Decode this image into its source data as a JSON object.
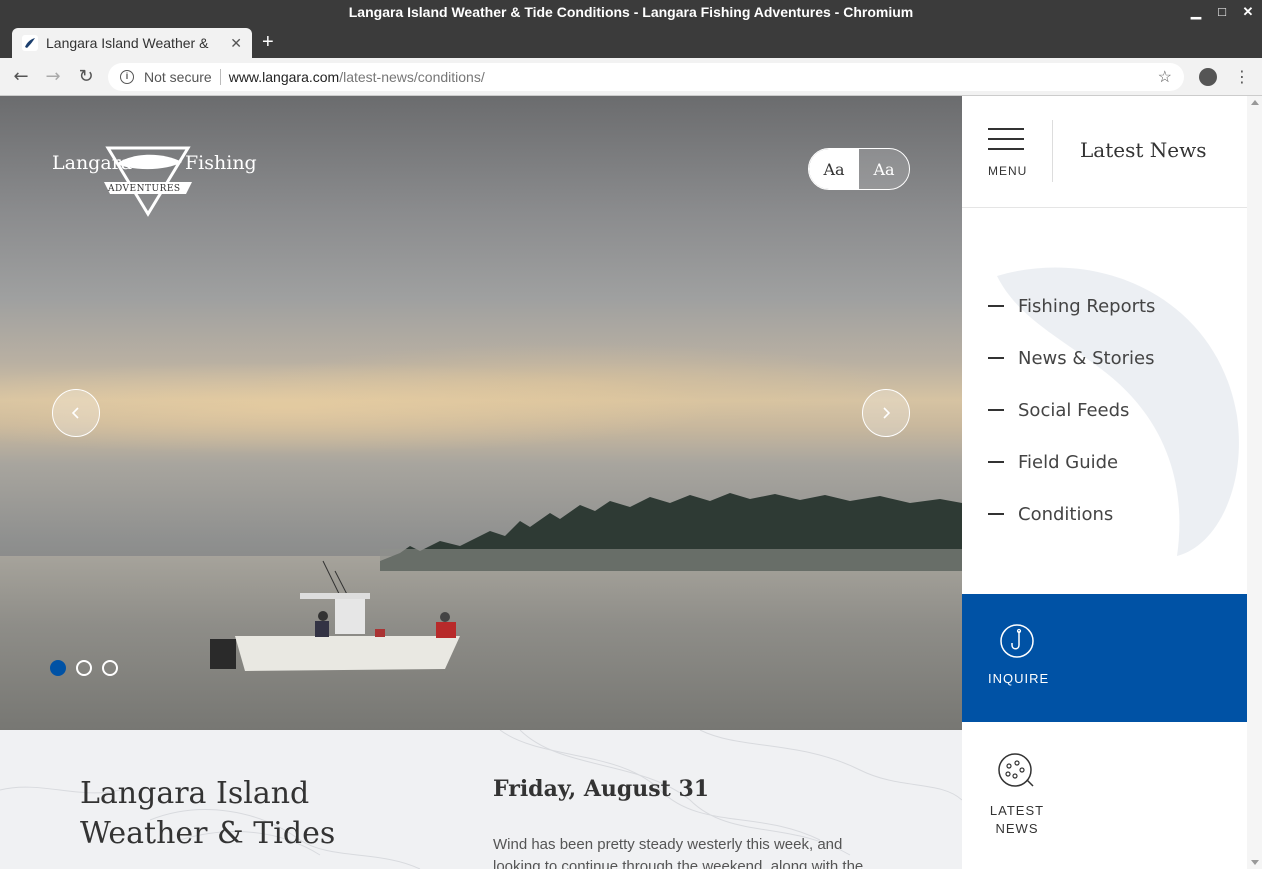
{
  "window": {
    "title": "Langara Island Weather & Tide Conditions - Langara Fishing Adventures - Chromium"
  },
  "tab": {
    "title": "Langara Island Weather &",
    "close": "✕",
    "new_tab": "+"
  },
  "toolbar": {
    "back": "←",
    "forward": "→",
    "reload": "↻",
    "security_text": "Not secure",
    "url_host": "www.langara.com",
    "url_path": "/latest-news/conditions/",
    "bookmark": "☆",
    "menu": "⋮"
  },
  "hero": {
    "logo_left": "Langara",
    "logo_right": "Fishing",
    "logo_banner": "ADVENTURES",
    "font_toggle": [
      "Aa",
      "Aa"
    ],
    "slides": 3,
    "active_slide": 0
  },
  "content": {
    "heading": "Langara Island Weather & Tides",
    "date": "Friday, August 31",
    "body": "Wind has been pretty steady westerly this week, and looking to continue through the weekend, along with the usual mix"
  },
  "sidebar": {
    "menu_label": "MENU",
    "title": "Latest News",
    "nav": [
      {
        "label": "Fishing Reports"
      },
      {
        "label": "News & Stories"
      },
      {
        "label": "Social Feeds"
      },
      {
        "label": "Field Guide"
      },
      {
        "label": "Conditions"
      }
    ],
    "inquire_label": "INQUIRE",
    "latest_label": "LATEST NEWS"
  },
  "colors": {
    "brand_blue": "#0052a5"
  }
}
